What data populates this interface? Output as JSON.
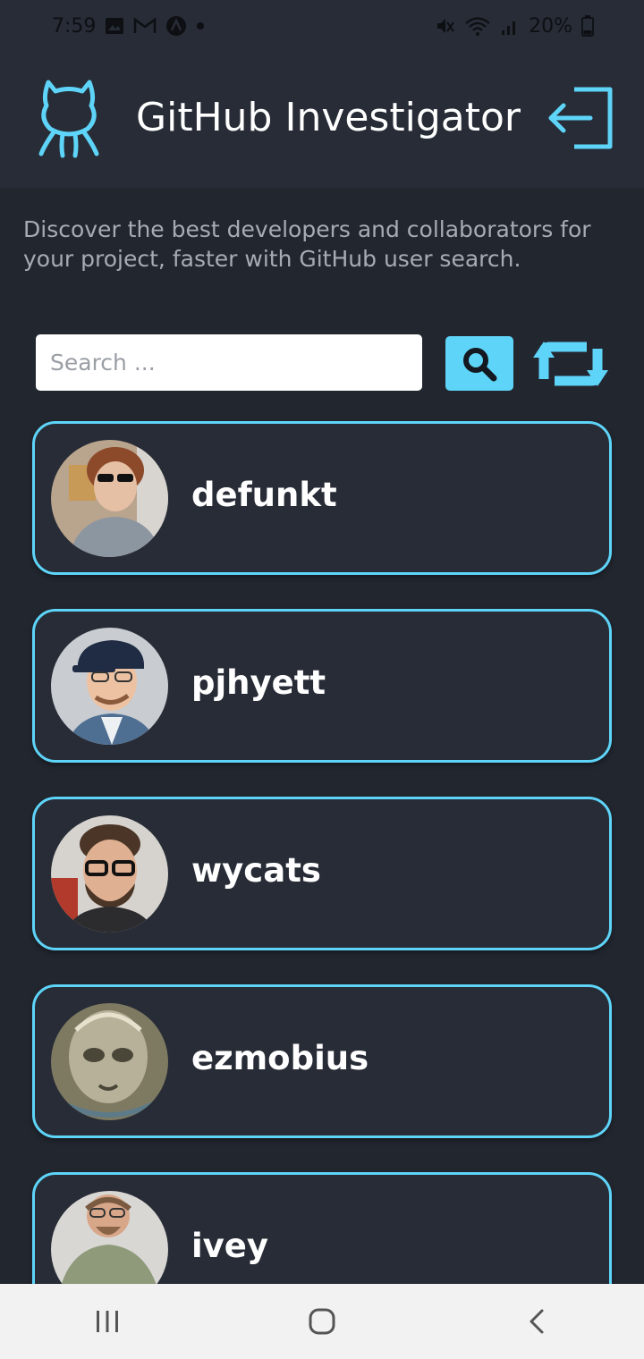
{
  "status_bar": {
    "time": "7:59",
    "battery": "20%"
  },
  "header": {
    "title": "GitHub Investigator"
  },
  "tagline": "Discover the best developers and collaborators for your project, faster with GitHub user search.",
  "search": {
    "placeholder": "Search ...",
    "value": ""
  },
  "users": [
    {
      "login": "defunkt"
    },
    {
      "login": "pjhyett"
    },
    {
      "login": "wycats"
    },
    {
      "login": "ezmobius"
    },
    {
      "login": "ivey"
    }
  ],
  "colors": {
    "accent": "#5ed4f8",
    "background": "#22262f",
    "card": "#272c36",
    "text_muted": "#a7abb3",
    "nav_bar": "#f2f2f2"
  },
  "icons": {
    "header_logo": "github-octocat-icon",
    "logout": "logout-icon",
    "search": "search-icon",
    "refresh": "refresh-icon",
    "nav_recents": "recents-icon",
    "nav_home": "home-icon",
    "nav_back": "back-icon"
  }
}
